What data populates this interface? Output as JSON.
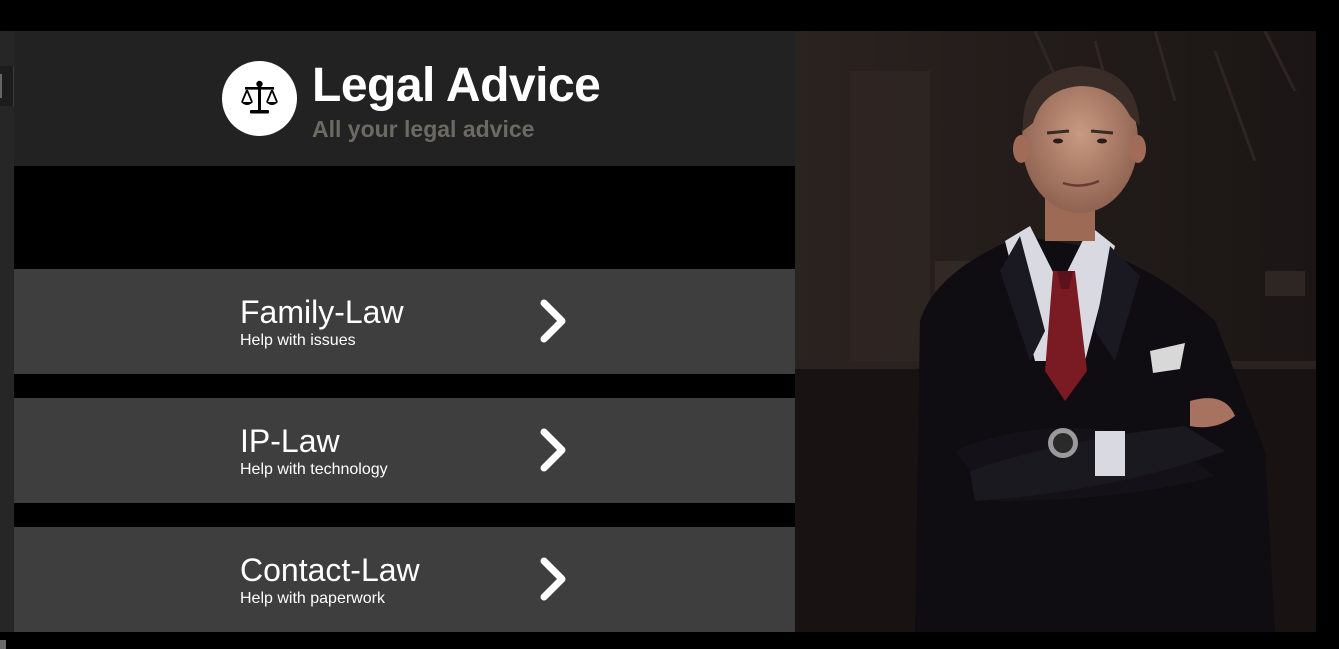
{
  "brand": {
    "title": "Legal Advice",
    "subtitle": "All your legal advice",
    "logo_icon": "scales-icon"
  },
  "cards": [
    {
      "title": "Family-Law",
      "subtitle": "Help with issues",
      "icon": "chevron-right-icon"
    },
    {
      "title": "IP-Law",
      "subtitle": "Help with technology",
      "icon": "chevron-right-icon"
    },
    {
      "title": "Contact-Law",
      "subtitle": "Help with paperwork",
      "icon": "chevron-right-icon"
    }
  ],
  "hero_image": {
    "subject": "man-in-suit-photo"
  },
  "colors": {
    "page_background": "#000000",
    "header_background": "#222222",
    "card_background": "#3e3e3e",
    "title_text": "#ffffff",
    "subtitle_text": "#6b6b63"
  }
}
